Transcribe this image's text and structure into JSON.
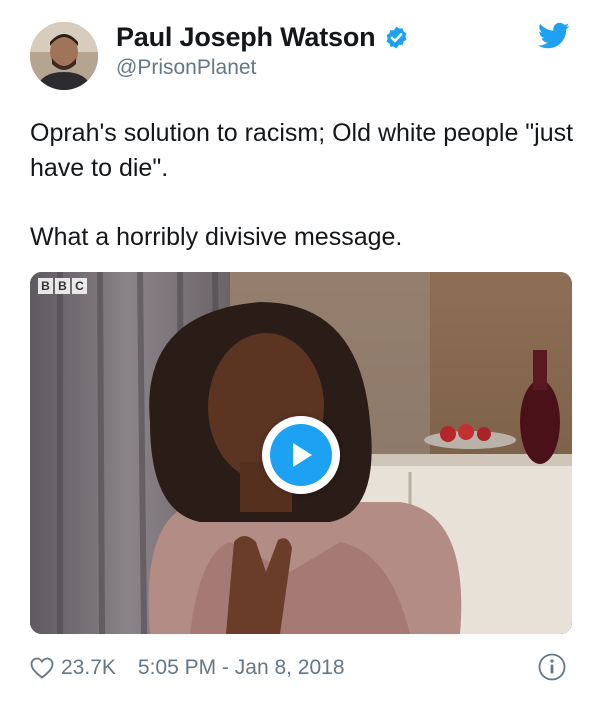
{
  "author": {
    "name": "Paul Joseph Watson",
    "handle": "@PrisonPlanet",
    "verified": true
  },
  "tweet": {
    "text_line1": "Oprah's solution to racism; Old white people \"just have to die\".",
    "text_line2": "What a horribly divisive message."
  },
  "media": {
    "type": "video",
    "watermark": [
      "B",
      "B",
      "C"
    ]
  },
  "footer": {
    "likes": "23.7K",
    "timestamp": "5:05 PM - Jan 8, 2018"
  },
  "icons": {
    "verified": "verified-badge-icon",
    "brand": "twitter-bird-icon",
    "like": "heart-icon",
    "play": "play-icon",
    "info": "info-icon"
  },
  "colors": {
    "brand_blue": "#1da1f2",
    "secondary_text": "#657786",
    "primary_text": "#14171a"
  }
}
